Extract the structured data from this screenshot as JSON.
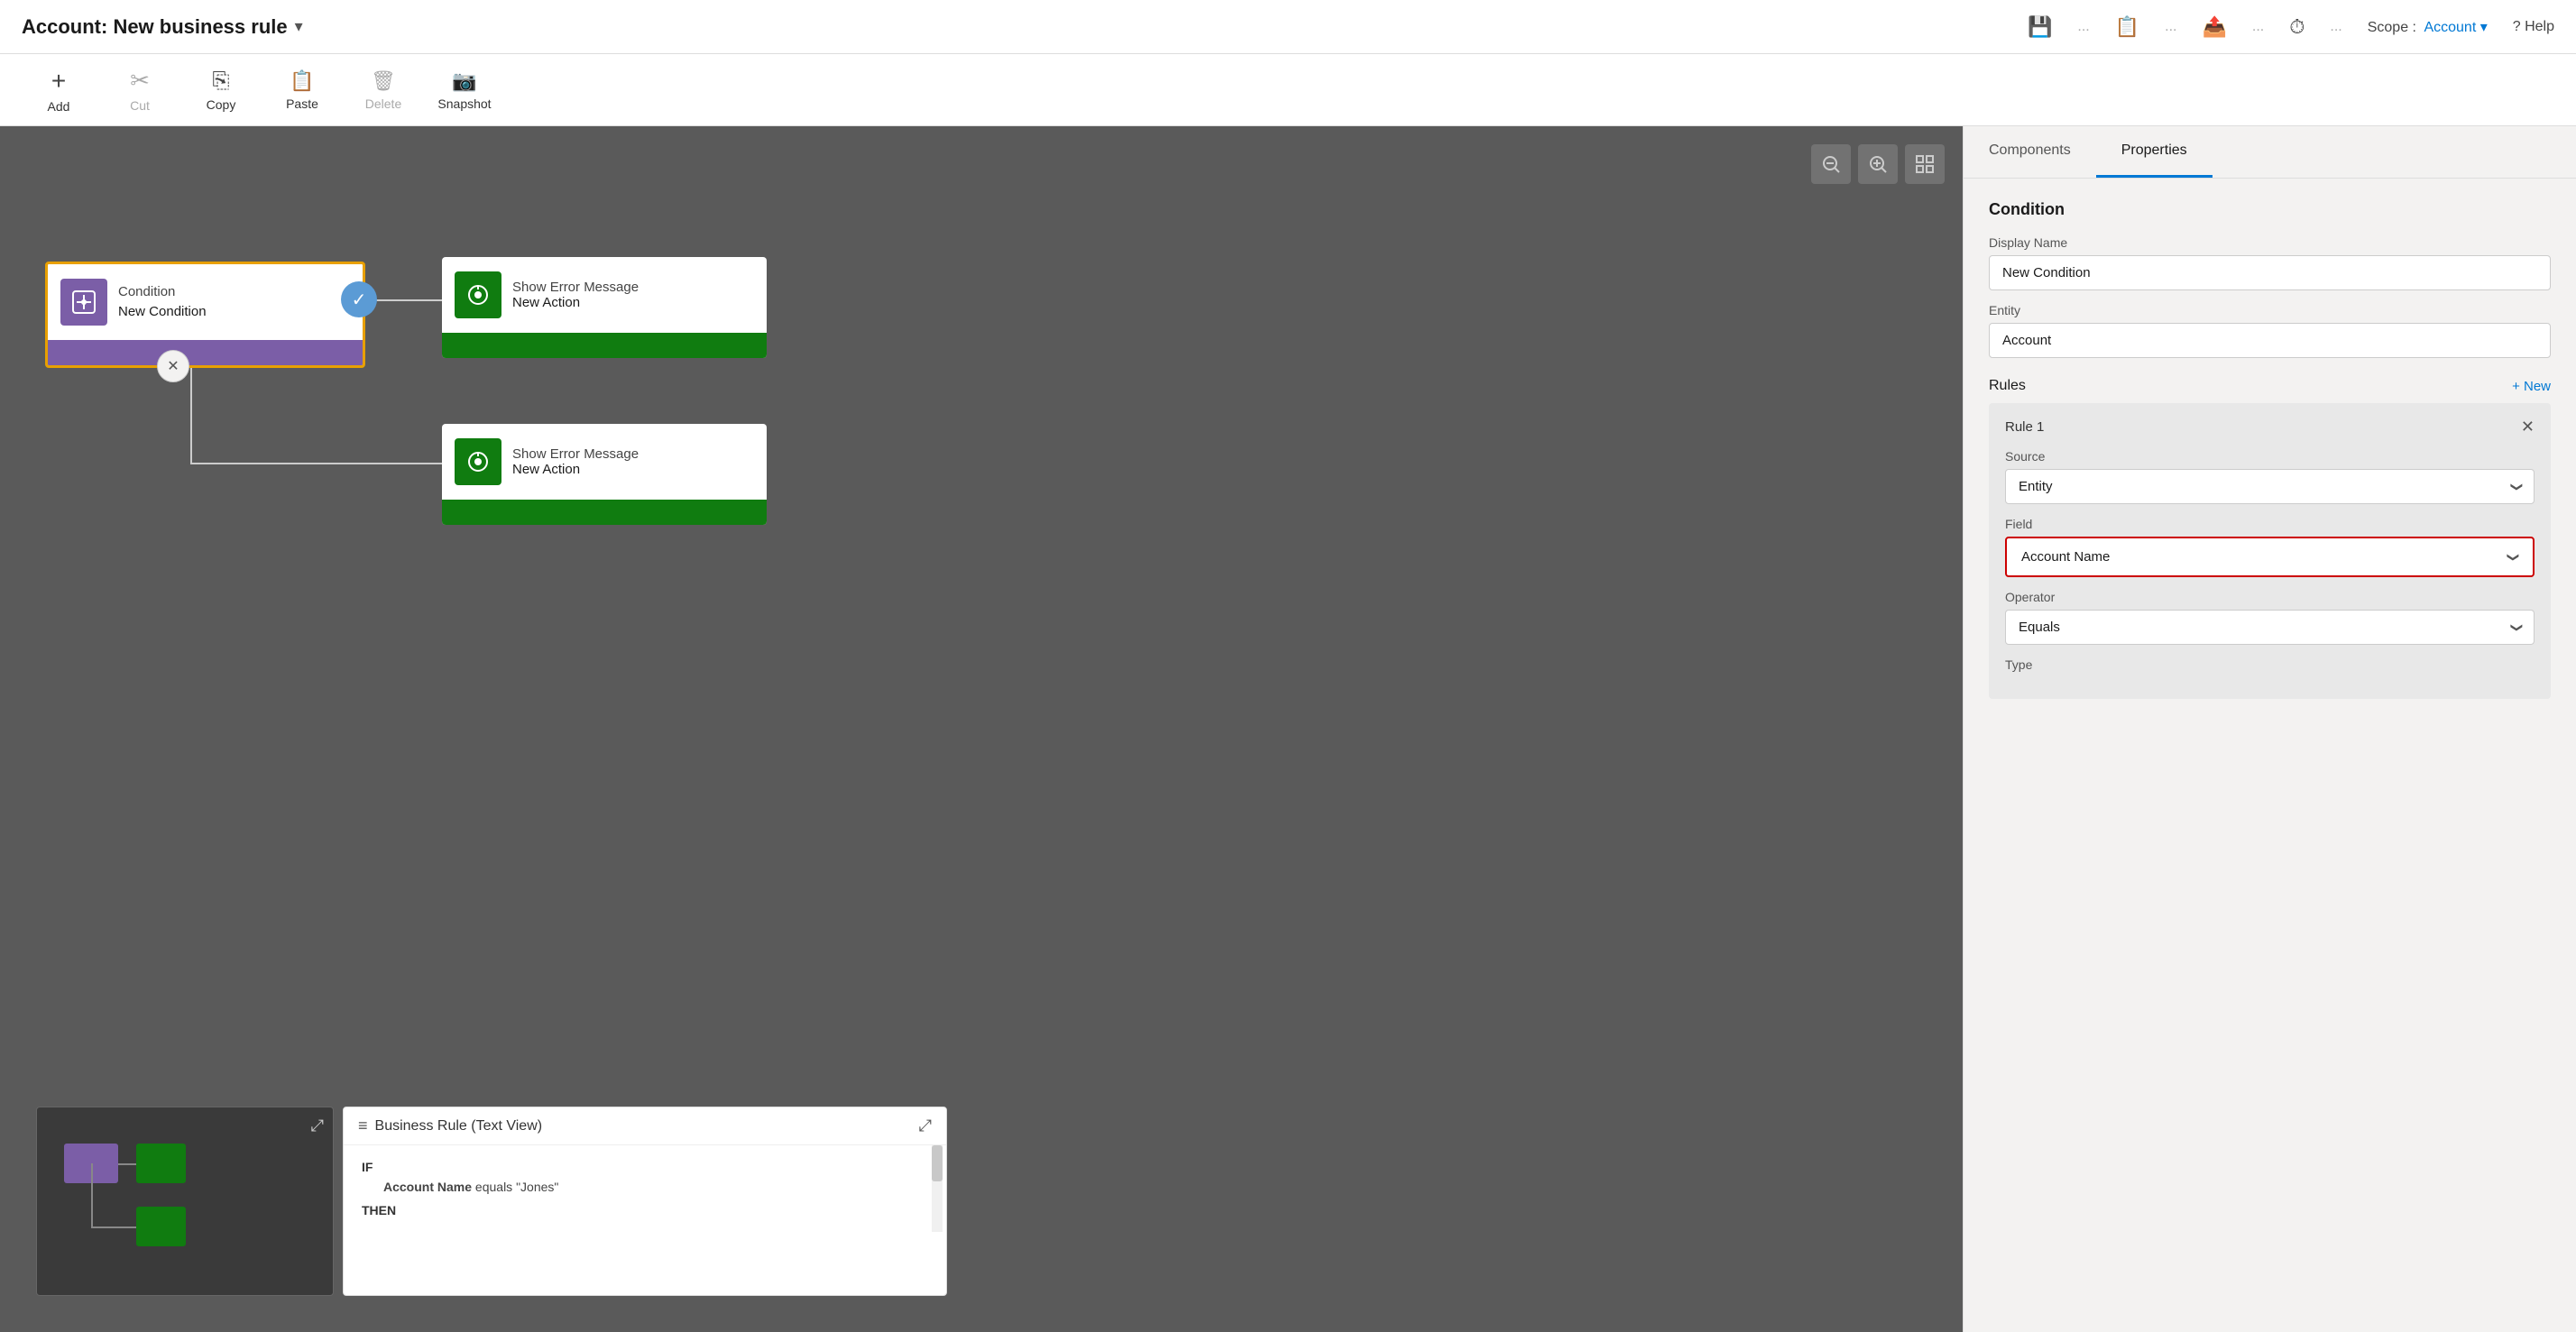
{
  "titleBar": {
    "title": "Account: New business rule",
    "chevronIcon": "▾",
    "icons": [
      "💾",
      "📋",
      "📤",
      "⏱"
    ],
    "scopeLabel": "Scope :",
    "scopeValue": "Account",
    "helpLabel": "? Help"
  },
  "toolbar": {
    "items": [
      {
        "id": "add",
        "icon": "+",
        "label": "Add",
        "disabled": false
      },
      {
        "id": "cut",
        "icon": "✂",
        "label": "Cut",
        "disabled": true
      },
      {
        "id": "copy",
        "icon": "⎘",
        "label": "Copy",
        "disabled": false
      },
      {
        "id": "paste",
        "icon": "📋",
        "label": "Paste",
        "disabled": false
      },
      {
        "id": "delete",
        "icon": "🗑",
        "label": "Delete",
        "disabled": true
      },
      {
        "id": "snapshot",
        "icon": "📷",
        "label": "Snapshot",
        "disabled": false
      }
    ]
  },
  "canvas": {
    "conditionNode": {
      "typeLabel": "Condition",
      "nameLabel": "New Condition"
    },
    "actionNodeTop": {
      "typeLabel": "Show Error Message",
      "nameLabel": "New Action"
    },
    "actionNodeBottom": {
      "typeLabel": "Show Error Message",
      "nameLabel": "New Action"
    }
  },
  "textView": {
    "title": "Business Rule (Text View)",
    "ifLabel": "IF",
    "thenLabel": "THEN",
    "condition": "Account Name equals \"Jones\"",
    "action": ""
  },
  "rightPanel": {
    "tabs": [
      {
        "id": "components",
        "label": "Components",
        "active": false
      },
      {
        "id": "properties",
        "label": "Properties",
        "active": true
      }
    ],
    "sectionTitle": "Condition",
    "displayNameLabel": "Display Name",
    "displayNameValue": "New Condition",
    "entityLabel": "Entity",
    "entityValue": "Account",
    "rulesLabel": "Rules",
    "rulesNewLabel": "+ New",
    "rule": {
      "name": "Rule 1",
      "sourceLabel": "Source",
      "sourceValue": "Entity",
      "fieldLabel": "Field",
      "fieldValue": "Account Name",
      "operatorLabel": "Operator",
      "operatorValue": "Equals",
      "typeLabel": "Type"
    }
  }
}
